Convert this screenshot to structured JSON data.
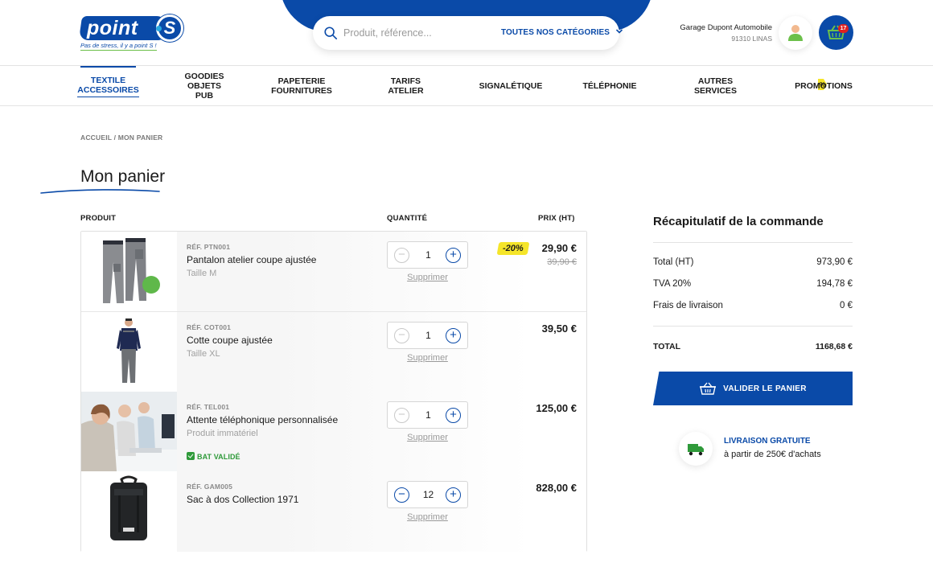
{
  "brand": {
    "name": "point",
    "letter": "S",
    "tagline": "Pas de stress, il y a point S !"
  },
  "search": {
    "placeholder": "Produit, référence...",
    "category_label": "TOUTES NOS CATÉGORIES"
  },
  "account": {
    "name": "Garage Dupont Automobile",
    "city": "91310 LINAS"
  },
  "cart": {
    "count": "17"
  },
  "nav": [
    {
      "label": "TEXTILE\nACCESSOIRES",
      "active": true
    },
    {
      "label": "GOODIES\nOBJETS PUB"
    },
    {
      "label": "PAPETERIE\nFOURNITURES"
    },
    {
      "label": "TARIFS ATELIER"
    },
    {
      "label": "SIGNALÉTIQUE"
    },
    {
      "label": "TÉLÉPHONIE"
    },
    {
      "label": "AUTRES SERVICES"
    },
    {
      "label": "PROMOTIONS"
    }
  ],
  "breadcrumb": {
    "home": "ACCUEIL",
    "separator": " / ",
    "current": "MON PANIER"
  },
  "page": {
    "title": "Mon panier"
  },
  "table_headers": {
    "product": "PRODUIT",
    "quantity": "QUANTITÉ",
    "price": "PRIX (HT)"
  },
  "items": [
    {
      "ref": "RÉF. PTN001",
      "name": "Pantalon atelier coupe ajustée",
      "variant": "Taille M",
      "qty": "1",
      "remove": "Supprimer",
      "price": "29,90 €",
      "old_price": "39,90 €",
      "discount": "-20%"
    },
    {
      "ref": "RÉF. COT001",
      "name": "Cotte coupe ajustée",
      "variant": "Taille XL",
      "qty": "1",
      "remove": "Supprimer",
      "price": "39,50 €"
    },
    {
      "ref": "RÉF. TEL001",
      "name": "Attente téléphonique personnalisée",
      "variant": "Produit immatériel",
      "bat": "BAT VALIDÉ",
      "qty": "1",
      "remove": "Supprimer",
      "price": "125,00 €"
    },
    {
      "ref": "RÉF. GAM005",
      "name": "Sac à dos Collection 1971",
      "qty": "12",
      "remove": "Supprimer",
      "price": "828,00 €"
    }
  ],
  "summary": {
    "title": "Récapitulatif de la commande",
    "total_ht_label": "Total (HT)",
    "total_ht": "973,90 €",
    "tva_label": "TVA 20%",
    "tva": "194,78 €",
    "shipping_label": "Frais de livraison",
    "shipping": "0 €",
    "total_label": "TOTAL",
    "total": "1168,68 €",
    "validate_label": "VALIDER LE PANIER"
  },
  "free_shipping": {
    "title": "LIVRAISON GRATUITE",
    "subtitle": "à partir de 250€ d'achats"
  },
  "colors": {
    "brand_blue": "#0a4aa8",
    "promo_yellow": "#f5e52a",
    "success_green": "#2f9a3a",
    "badge_red": "#e02020"
  }
}
